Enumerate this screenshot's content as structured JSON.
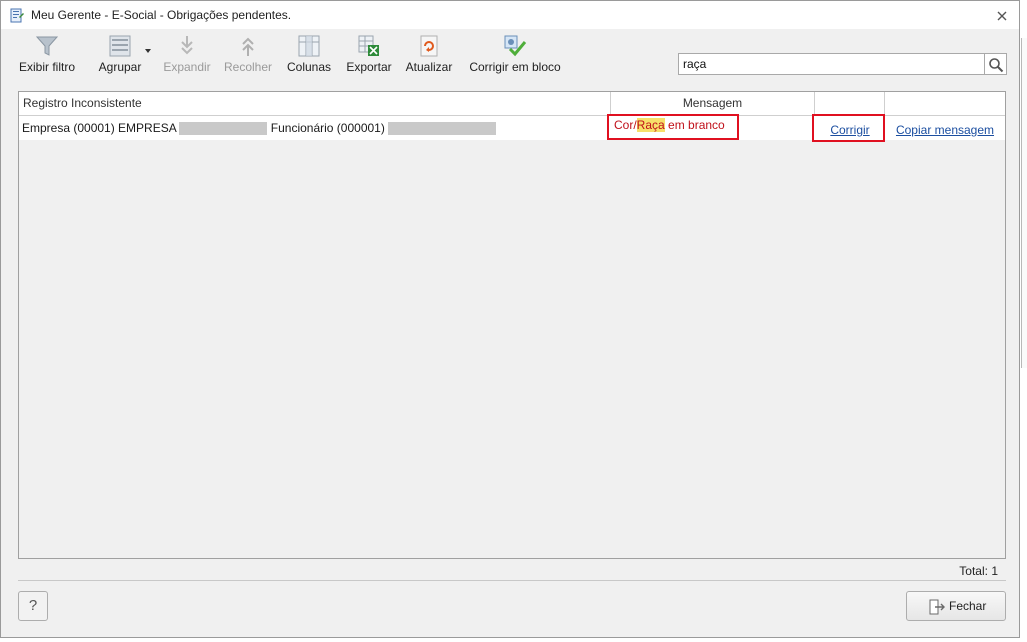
{
  "window": {
    "title": "Meu Gerente - E-Social - Obrigações pendentes."
  },
  "toolbar": {
    "items": [
      {
        "label": "Exibir filtro",
        "icon": "funnel-icon",
        "enabled": true
      },
      {
        "label": "Agrupar",
        "icon": "group-icon",
        "enabled": true
      },
      {
        "label": "Expandir",
        "icon": "expand-icon",
        "enabled": false
      },
      {
        "label": "Recolher",
        "icon": "collapse-icon",
        "enabled": false
      },
      {
        "label": "Colunas",
        "icon": "columns-icon",
        "enabled": true
      },
      {
        "label": "Exportar",
        "icon": "export-excel-icon",
        "enabled": true
      },
      {
        "label": "Atualizar",
        "icon": "refresh-icon",
        "enabled": true
      },
      {
        "label": "Corrigir em bloco",
        "icon": "bulk-fix-icon",
        "enabled": true
      }
    ]
  },
  "search": {
    "value": "raça"
  },
  "grid": {
    "columns": [
      "Registro Inconsistente",
      "Mensagem",
      "",
      ""
    ],
    "rows": [
      {
        "empresa_prefix": "Empresa (00001) EMPRESA",
        "funcionario_prefix": "Funcionário (000001)",
        "message_before": "Cor/",
        "message_highlight": "Raça",
        "message_after": " em branco",
        "action_fix": "Corrigir",
        "action_copy": "Copiar mensagem"
      }
    ]
  },
  "footer": {
    "total": "Total: 1",
    "help_label": "?",
    "close_label": "Fechar"
  },
  "colors": {
    "highlight_box": "#e01020",
    "message_text": "#c0101a",
    "search_highlight": "#f7e06a",
    "link": "#1b4ea0"
  }
}
